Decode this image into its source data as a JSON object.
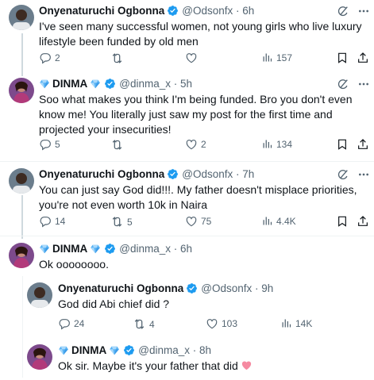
{
  "tweets": [
    {
      "name": "Onyenaturuchi Ogbonna",
      "verified": true,
      "handle": "@Odsonfx",
      "time": "6h",
      "text": "I've seen many successful women, not young girls who live luxury lifestyle been funded by old men",
      "replies": "2",
      "retweets": "",
      "likes": "",
      "views": "157"
    },
    {
      "name": "DINMA",
      "verified": true,
      "handle": "@dinma_x",
      "time": "5h",
      "text": "Soo what makes you think I'm being funded. Bro you don't even know me! You literally just saw my post for the first time and projected your insecurities!",
      "replies": "5",
      "retweets": "",
      "likes": "2",
      "views": "134"
    },
    {
      "name": "Onyenaturuchi Ogbonna",
      "verified": true,
      "handle": "@Odsonfx",
      "time": "7h",
      "text": "You can just say God did!!!. My father doesn't misplace priorities, you're not even worth 10k in Naira",
      "replies": "14",
      "retweets": "5",
      "likes": "75",
      "views": "4.4K"
    },
    {
      "name": "DINMA",
      "verified": true,
      "handle": "@dinma_x",
      "time": "6h",
      "text": "Ok oooooooo.",
      "replies": "",
      "retweets": "",
      "likes": "",
      "views": ""
    },
    {
      "name": "Onyenaturuchi Ogbonna",
      "verified": true,
      "handle": "@Odsonfx",
      "time": "9h",
      "text": "God did Abi chief did ?",
      "replies": "24",
      "retweets": "4",
      "likes": "103",
      "views": "14K"
    },
    {
      "name": "DINMA",
      "verified": true,
      "handle": "@dinma_x",
      "time": "8h",
      "text": "Ok sir. Maybe it's your father that did",
      "replies": "",
      "retweets": "",
      "likes": "",
      "views": ""
    }
  ],
  "colors": {
    "verified": "#1d9bf0",
    "diamond": "#5ab4f5",
    "heart": "#f58aa1",
    "muted": "#536471"
  },
  "icons": [
    "verified-badge-icon",
    "diamond-emoji-icon",
    "grok-icon",
    "more-icon",
    "reply-icon",
    "retweet-icon",
    "like-icon",
    "views-icon",
    "bookmark-icon",
    "share-icon",
    "heart-emoji-icon"
  ]
}
